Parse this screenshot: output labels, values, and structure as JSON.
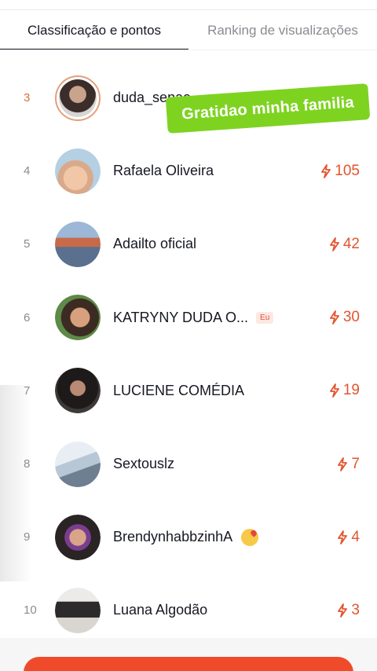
{
  "tabs": [
    {
      "label": "Classificação e pontos"
    },
    {
      "label": "Ranking de visualizações"
    }
  ],
  "sticker_text": "Gratidao minha familia",
  "rows": [
    {
      "rank": "3",
      "name": "duda_senaa",
      "points": ""
    },
    {
      "rank": "4",
      "name": "Rafaela Oliveira",
      "points": "105"
    },
    {
      "rank": "5",
      "name": "Adailto oficial",
      "points": "42"
    },
    {
      "rank": "6",
      "name": "KATRYNY DUDA O...",
      "badge": "Eu",
      "points": "30"
    },
    {
      "rank": "7",
      "name": "LUCIENE COMÉDIA",
      "points": "19"
    },
    {
      "rank": "8",
      "name": "Sextouslz",
      "points": "7"
    },
    {
      "rank": "9",
      "name": "BrendynhabbzinhA",
      "points": "4"
    },
    {
      "rank": "10",
      "name": "Luana Algodão",
      "points": "3"
    }
  ],
  "colors": {
    "accent": "#e2552e",
    "sticker": "#7ed321",
    "button": "#ef4b2b"
  },
  "icons": {
    "points": "lightning-icon",
    "emoji": "smiling-face-with-hearts-icon"
  }
}
